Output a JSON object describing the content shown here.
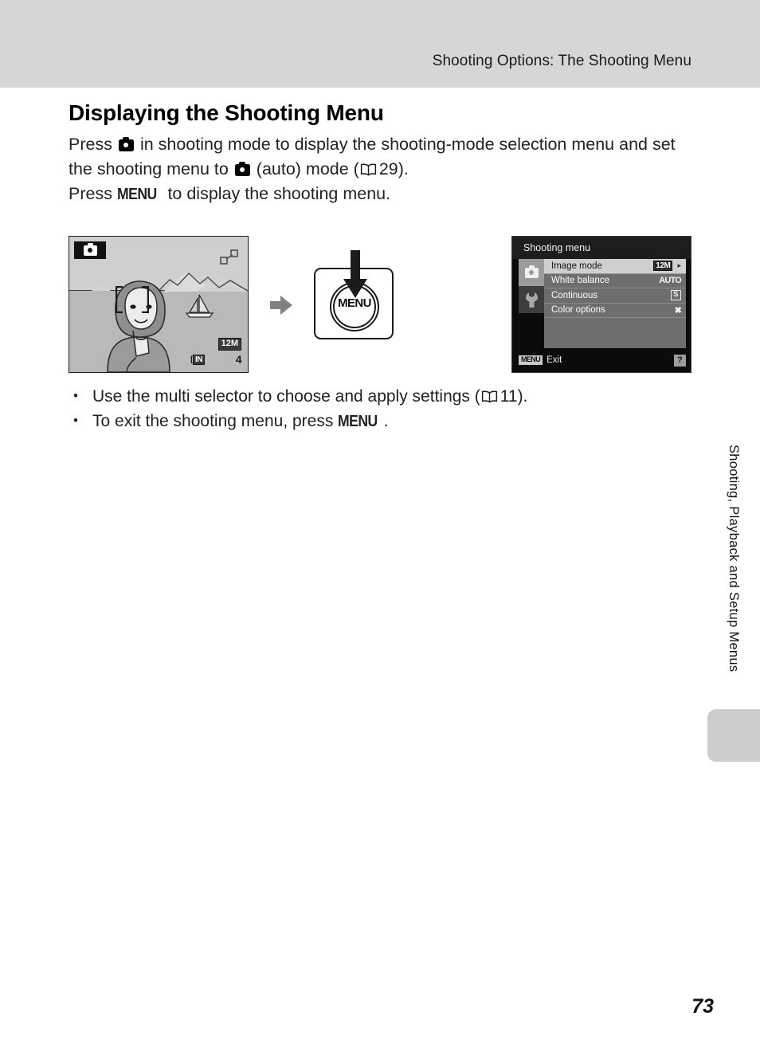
{
  "header": {
    "running_title": "Shooting Options: The Shooting Menu"
  },
  "heading": "Displaying the Shooting Menu",
  "body": {
    "para1_part1": "Press",
    "para1_part2": "in shooting mode to display the shooting-mode selection menu and set the shooting menu to",
    "para1_part3": "(auto) mode (",
    "para1_page_ref": "29",
    "para1_part4": ").",
    "para2_part1": "Press",
    "para2_menu_label": "MENU",
    "para2_part2": "to display the shooting menu."
  },
  "figure": {
    "lcd": {
      "mode_icon": "camera-auto-icon",
      "af_icon": "af-macro-icon",
      "image_mode_badge": "12M",
      "memory_label": "IN",
      "shots_remaining": "4"
    },
    "button": {
      "label": "MENU",
      "press_arrow": "down-arrow-icon"
    },
    "arrow1": "flow-arrow-right",
    "arrow2": "flow-arrow-right",
    "menu_screen": {
      "title": "Shooting menu",
      "tabs": [
        {
          "name": "shooting-tab",
          "icon": "camera-icon",
          "active": true
        },
        {
          "name": "setup-tab",
          "icon": "wrench-icon",
          "active": false
        }
      ],
      "rows": [
        {
          "label": "Image mode",
          "value": "12M",
          "value_style": "chip",
          "selected": true,
          "caret": "▸"
        },
        {
          "label": "White balance",
          "value": "AUTO",
          "value_style": "plain",
          "selected": false,
          "caret": ""
        },
        {
          "label": "Continuous",
          "value": "S",
          "value_style": "box",
          "selected": false,
          "caret": ""
        },
        {
          "label": "Color options",
          "value": "✖",
          "value_style": "plain",
          "selected": false,
          "caret": ""
        }
      ],
      "footer": {
        "menu_chip": "MENU",
        "exit_label": "Exit",
        "help_label": "?"
      }
    }
  },
  "bullets": [
    {
      "part1": "Use the multi selector to choose and apply settings (",
      "page_ref": "11",
      "part2": ")."
    },
    {
      "part1": "To exit the shooting menu, press",
      "menu_label": "MENU",
      "part2": "."
    }
  ],
  "side_tab_title": "Shooting, Playback and Setup Menus",
  "page_number": "73",
  "colors": {
    "header_band": "#d6d6d6",
    "side_thumb": "#cccccc",
    "arrow_gray": "#808080",
    "menu_selected": "#cfcfcf"
  }
}
